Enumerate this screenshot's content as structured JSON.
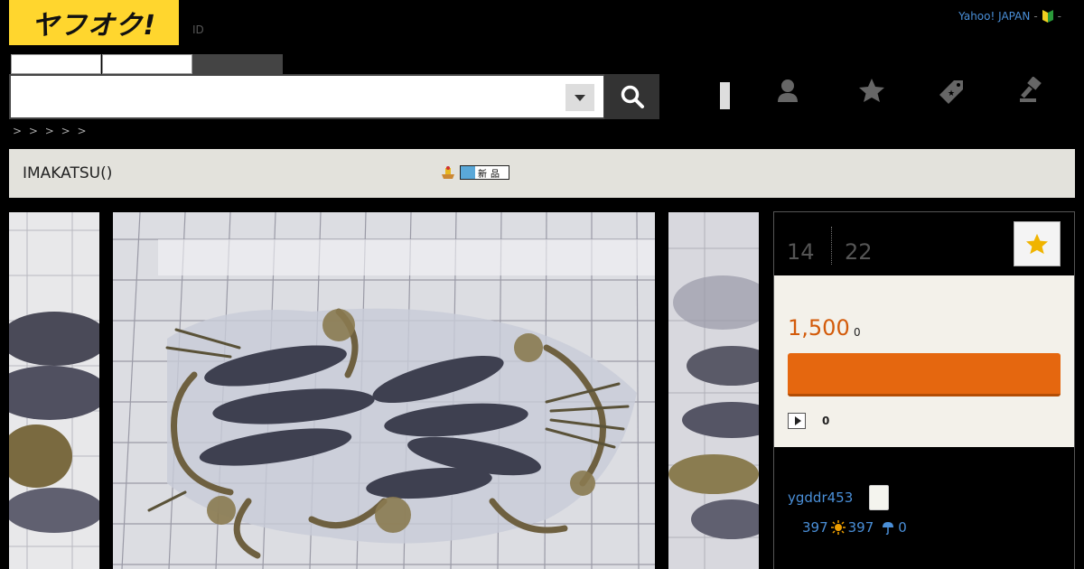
{
  "header": {
    "logo_text": "ヤフオク!",
    "id_label": "ID",
    "top_links": {
      "yahoo": "Yahoo! JAPAN",
      "sep1": "-",
      "sep2": "-"
    }
  },
  "search": {
    "tabs": [
      "",
      "",
      ""
    ],
    "input_value": "",
    "placeholder": ""
  },
  "breadcrumb": ">    > > > >",
  "item": {
    "title": "IMAKATSU()",
    "new_badge": "新品"
  },
  "auction": {
    "remaining_days": "14",
    "remaining_hours": "22",
    "price": "1,500",
    "price_suffix": "0",
    "bid_count": "0"
  },
  "seller": {
    "name": "ygddr453",
    "total_rating": "397",
    "good_rating": "397",
    "bad_rating": "0"
  },
  "colors": {
    "logo_yellow": "#ffd62e",
    "price_orange": "#d35b0a",
    "bid_button": "#e5670f",
    "link_blue": "#4a8fd8"
  },
  "icons": [
    "search-icon",
    "dropdown-arrow-icon",
    "user-icon",
    "star-icon",
    "coupon-tag-icon",
    "auction-hammer-icon",
    "beginner-mark-icon",
    "play-icon",
    "sun-icon",
    "rain-icon"
  ]
}
